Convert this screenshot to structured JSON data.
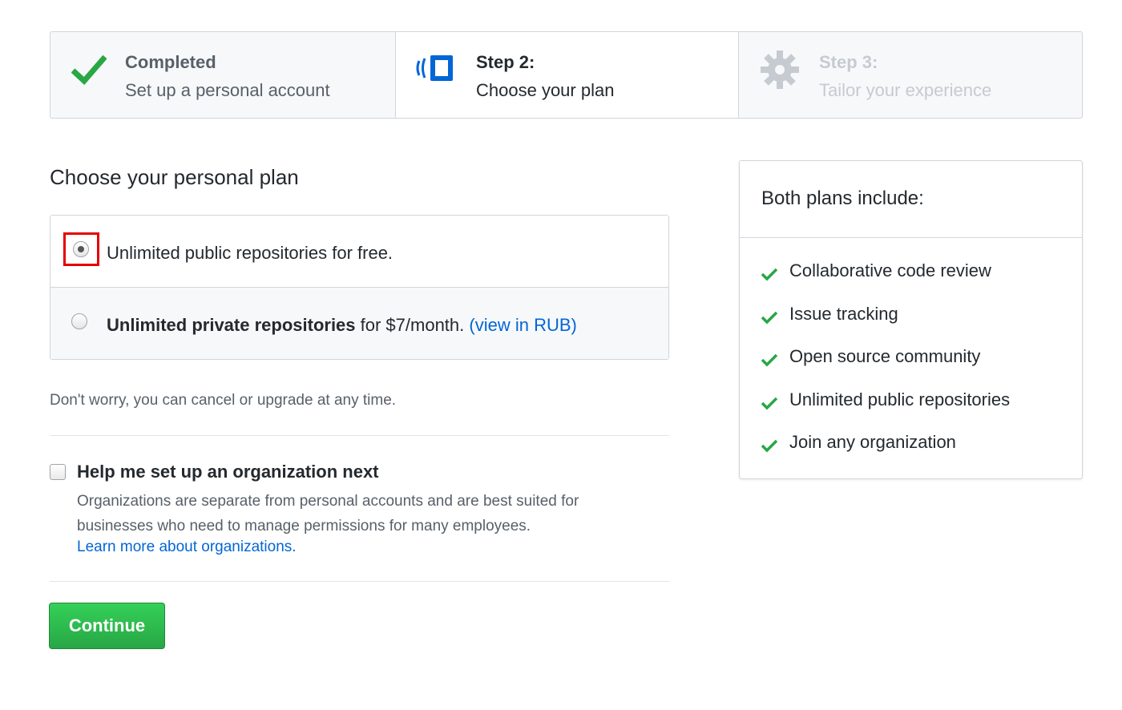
{
  "steps": [
    {
      "title": "Completed",
      "subtitle": "Set up a personal account",
      "icon": "checkmark-icon",
      "state": "completed"
    },
    {
      "title": "Step 2:",
      "subtitle": "Choose your plan",
      "icon": "plan-icon",
      "state": "current"
    },
    {
      "title": "Step 3:",
      "subtitle": "Tailor your experience",
      "icon": "gear-icon",
      "state": "upcoming"
    }
  ],
  "plan_heading": "Choose your personal plan",
  "plans": {
    "free": {
      "text": "Unlimited public repositories for free.",
      "selected": true
    },
    "paid": {
      "bold": "Unlimited private repositories",
      "text": " for $7/month. ",
      "link": "(view in RUB)",
      "selected": false
    }
  },
  "note": "Don't worry, you can cancel or upgrade at any time.",
  "organization": {
    "checked": false,
    "title": "Help me set up an organization next",
    "description": "Organizations are separate from personal accounts and are best suited for businesses who need to manage permissions for many employees.",
    "link": "Learn more about organizations."
  },
  "continue_label": "Continue",
  "side": {
    "title": "Both plans include:",
    "items": [
      "Collaborative code review",
      "Issue tracking",
      "Open source community",
      "Unlimited public repositories",
      "Join any organization"
    ]
  },
  "colors": {
    "success": "#28a745",
    "link": "#0366d6",
    "highlight": "#e60000"
  }
}
